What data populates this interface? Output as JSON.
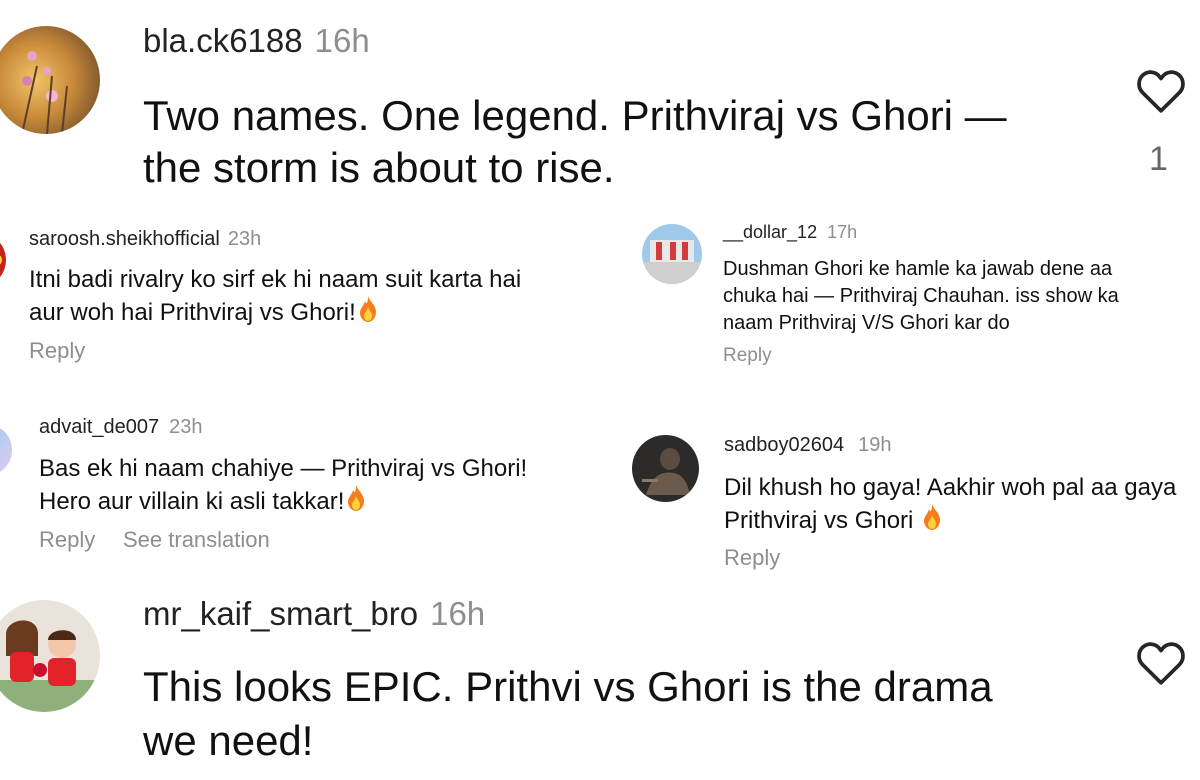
{
  "comments": [
    {
      "username": "bla.ck6188",
      "time": "16h",
      "text_l1": "Two names. One legend. Prithviraj vs Ghori —",
      "text_l2": "the storm is about to rise.",
      "likes": "1"
    },
    {
      "username": "saroosh.sheikhofficial",
      "time": "23h",
      "text_l1": "Itni badi rivalry ko sirf ek hi naam suit karta hai",
      "text_l2": "aur woh hai Prithviraj vs Ghori!",
      "reply": "Reply"
    },
    {
      "username": "__dollar_12",
      "time": "17h",
      "text_l1": "Dushman Ghori ke hamle ka jawab dene aa",
      "text_l2": "chuka hai — Prithviraj Chauhan. iss show ka",
      "text_l3": "naam Prithviraj V/S Ghori kar do",
      "reply": "Reply"
    },
    {
      "username": "advait_de007",
      "time": "23h",
      "text_l1": "Bas ek hi naam chahiye — Prithviraj vs Ghori!",
      "text_l2": "Hero aur villain ki asli takkar!",
      "reply": "Reply",
      "translate": "See translation"
    },
    {
      "username": "sadboy02604",
      "time": "19h",
      "text_l1": "Dil khush ho gaya! Aakhir woh pal aa gaya",
      "text_l2": "Prithviraj vs Ghori",
      "reply": "Reply"
    },
    {
      "username": "mr_kaif_smart_bro",
      "time": "16h",
      "text_l1": "This looks EPIC. Prithvi vs Ghori is the drama",
      "text_l2": "we need!"
    }
  ],
  "icons": {
    "like": "heart-outline-icon",
    "fire": "fire-emoji-icon"
  },
  "colors": {
    "secondary_text": "#8e8e8e",
    "heart_stroke": "#262626"
  }
}
